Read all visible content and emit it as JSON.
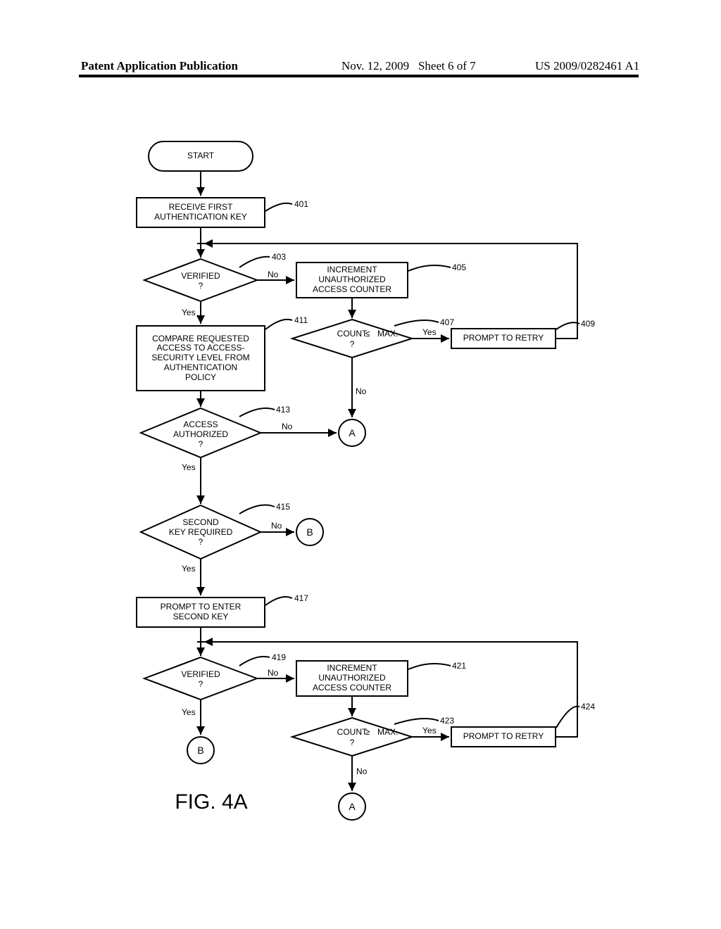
{
  "header": {
    "publication": "Patent Application Publication",
    "date": "Nov. 12, 2009",
    "sheet": "Sheet 6 of 7",
    "pubno": "US 2009/0282461 A1"
  },
  "figure_caption": "FIG. 4A",
  "nodes": {
    "start": "START",
    "n401": "RECEIVE FIRST\nAUTHENTICATION KEY",
    "n403": "VERIFIED\n?",
    "n405": "INCREMENT\nUNAUTHORIZED\nACCESS COUNTER",
    "n407": "COUNT ≤ MAX.\n?",
    "n409": "PROMPT TO RETRY",
    "n411": "COMPARE REQUESTED\nACCESS TO ACCESS-\nSECURITY LEVEL FROM\nAUTHENTICATION\nPOLICY",
    "n413": "ACCESS\nAUTHORIZED\n?",
    "n415": "SECOND\nKEY REQUIRED\n?",
    "n417": "PROMPT TO ENTER\nSECOND KEY",
    "n419": "VERIFIED\n?",
    "n421": "INCREMENT\nUNAUTHORIZED\nACCESS COUNTER",
    "n423": "COUNT ≥ MAX.\n?",
    "n424": "PROMPT TO RETRY",
    "offA": "A",
    "offB": "B"
  },
  "refs": {
    "r401": "401",
    "r403": "403",
    "r405": "405",
    "r407": "407",
    "r409": "409",
    "r411": "411",
    "r413": "413",
    "r415": "415",
    "r417": "417",
    "r419": "419",
    "r421": "421",
    "r423": "423",
    "r424": "424"
  },
  "labels": {
    "yes": "Yes",
    "no": "No"
  },
  "chart_data": {
    "type": "flowchart",
    "title": "FIG. 4A",
    "nodes": [
      {
        "id": "start",
        "type": "terminator",
        "text": "START"
      },
      {
        "id": "401",
        "type": "process",
        "text": "RECEIVE FIRST AUTHENTICATION KEY"
      },
      {
        "id": "403",
        "type": "decision",
        "text": "VERIFIED ?"
      },
      {
        "id": "405",
        "type": "process",
        "text": "INCREMENT UNAUTHORIZED ACCESS COUNTER"
      },
      {
        "id": "407",
        "type": "decision",
        "text": "COUNT ≤ MAX. ?"
      },
      {
        "id": "409",
        "type": "process",
        "text": "PROMPT TO RETRY"
      },
      {
        "id": "411",
        "type": "process",
        "text": "COMPARE REQUESTED ACCESS TO ACCESS-SECURITY LEVEL FROM AUTHENTICATION POLICY"
      },
      {
        "id": "413",
        "type": "decision",
        "text": "ACCESS AUTHORIZED ?"
      },
      {
        "id": "415",
        "type": "decision",
        "text": "SECOND KEY REQUIRED ?"
      },
      {
        "id": "417",
        "type": "process",
        "text": "PROMPT TO ENTER SECOND KEY"
      },
      {
        "id": "419",
        "type": "decision",
        "text": "VERIFIED ?"
      },
      {
        "id": "421",
        "type": "process",
        "text": "INCREMENT UNAUTHORIZED ACCESS COUNTER"
      },
      {
        "id": "423",
        "type": "decision",
        "text": "COUNT ≥ MAX. ?"
      },
      {
        "id": "424",
        "type": "process",
        "text": "PROMPT TO RETRY"
      },
      {
        "id": "A",
        "type": "offpage",
        "text": "A"
      },
      {
        "id": "B",
        "type": "offpage",
        "text": "B"
      }
    ],
    "edges": [
      {
        "from": "start",
        "to": "401"
      },
      {
        "from": "401",
        "to": "403"
      },
      {
        "from": "403",
        "to": "405",
        "label": "No"
      },
      {
        "from": "403",
        "to": "411",
        "label": "Yes"
      },
      {
        "from": "405",
        "to": "407"
      },
      {
        "from": "407",
        "to": "409",
        "label": "Yes"
      },
      {
        "from": "409",
        "to": "403",
        "note": "loop back"
      },
      {
        "from": "407",
        "to": "A",
        "label": "No"
      },
      {
        "from": "411",
        "to": "413"
      },
      {
        "from": "413",
        "to": "A",
        "label": "No"
      },
      {
        "from": "413",
        "to": "415",
        "label": "Yes"
      },
      {
        "from": "415",
        "to": "B",
        "label": "No"
      },
      {
        "from": "415",
        "to": "417",
        "label": "Yes"
      },
      {
        "from": "417",
        "to": "419"
      },
      {
        "from": "419",
        "to": "421",
        "label": "No"
      },
      {
        "from": "419",
        "to": "B",
        "label": "Yes"
      },
      {
        "from": "421",
        "to": "423"
      },
      {
        "from": "423",
        "to": "424",
        "label": "Yes"
      },
      {
        "from": "424",
        "to": "419",
        "note": "loop back"
      },
      {
        "from": "423",
        "to": "A",
        "label": "No"
      }
    ]
  }
}
